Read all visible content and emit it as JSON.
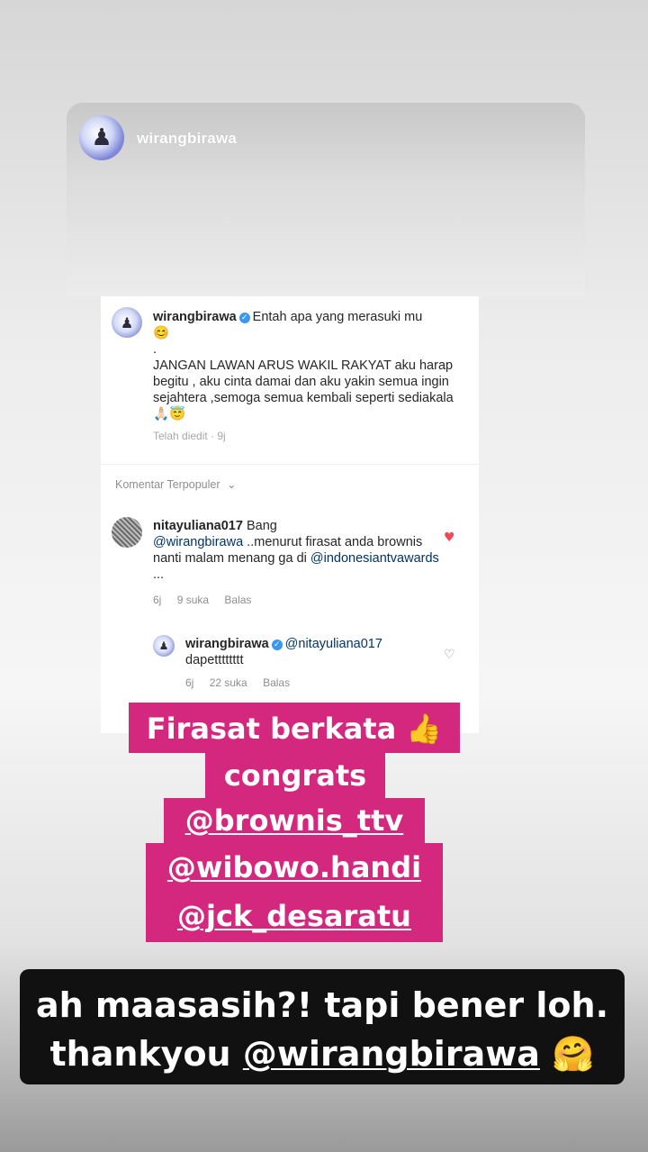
{
  "story": {
    "username": "wirangbirawa"
  },
  "post": {
    "author": "wirangbirawa",
    "caption_first": "Entah apa yang merasuki mu",
    "emoji_smile": "😊",
    "dot": ".",
    "caption_body": "JANGAN LAWAN ARUS WAKIL RAKYAT aku harap begitu , aku cinta damai dan aku yakin semua ingin sejahtera ,semoga semua kembali seperti sediakala",
    "emoji_end": "🙏🏻😇",
    "edited": "Telah diedit · 9j"
  },
  "comments": {
    "header": "Komentar Terpopuler",
    "items": [
      {
        "user": "nitayuliana017",
        "text_lead": "Bang",
        "mention": "@wirangbirawa",
        "text_body": " ..menurut firasat anda brownis nanti malam menang ga di ",
        "mention2": "@indonesiantvawards",
        "text_tail": " ...",
        "time": "6j",
        "likes": "9 suka",
        "reply": "Balas"
      },
      {
        "user": "wirangbirawa",
        "mention": "@nitayuliana017",
        "text": "dapetttttttt",
        "time": "6j",
        "likes": "22 suka",
        "reply": "Balas"
      }
    ]
  },
  "sticker": {
    "line1": "Firasat berkata",
    "emoji": "👍",
    "line2": "congrats",
    "line3": "@brownis_ttv",
    "line4": "@wibowo.handi",
    "line5": "@jck_desaratu",
    "color": "#d4287e"
  },
  "caption": {
    "line1": "ah maasasih?! tapi bener loh.",
    "line2_prefix": "thankyou ",
    "line2_mention": "@wirangbirawa",
    "emoji": "🤗"
  }
}
